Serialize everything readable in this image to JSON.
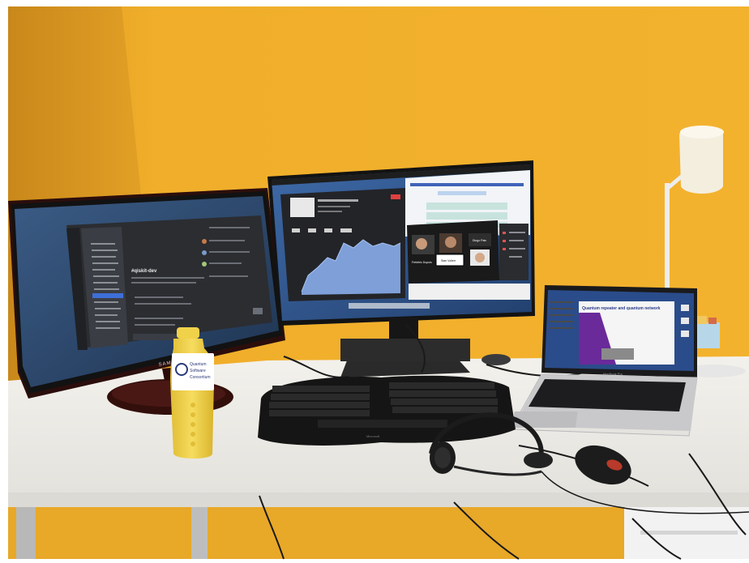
{
  "colors": {
    "wall": "#f0ae2a",
    "wall_shadow": "#d48f16",
    "desk": "#f4f2ee",
    "monitor_frame": "#1c1c1e",
    "samsung_bezel": "#5a1410",
    "screen_dark": "#2a2d33",
    "screen_blue": "#3b5f8f",
    "bottle": "#f2d24a",
    "laptop_silver": "#c9c9cc"
  },
  "left_monitor": {
    "brand": "SAMSUNG",
    "app_channel": "#qiskit-dev"
  },
  "center_monitor": {
    "names": [
      "Frédéric Dupuis",
      "Stan Vollerr",
      "Diogo Pais"
    ]
  },
  "laptop": {
    "slide_title": "Quantum repeater and quantum network",
    "model": "MacBook Pro"
  },
  "bottle": {
    "logo_lines": [
      "Quantum",
      "Software",
      "Consortium"
    ]
  },
  "keyboard": {
    "brand": "Microsoft"
  }
}
